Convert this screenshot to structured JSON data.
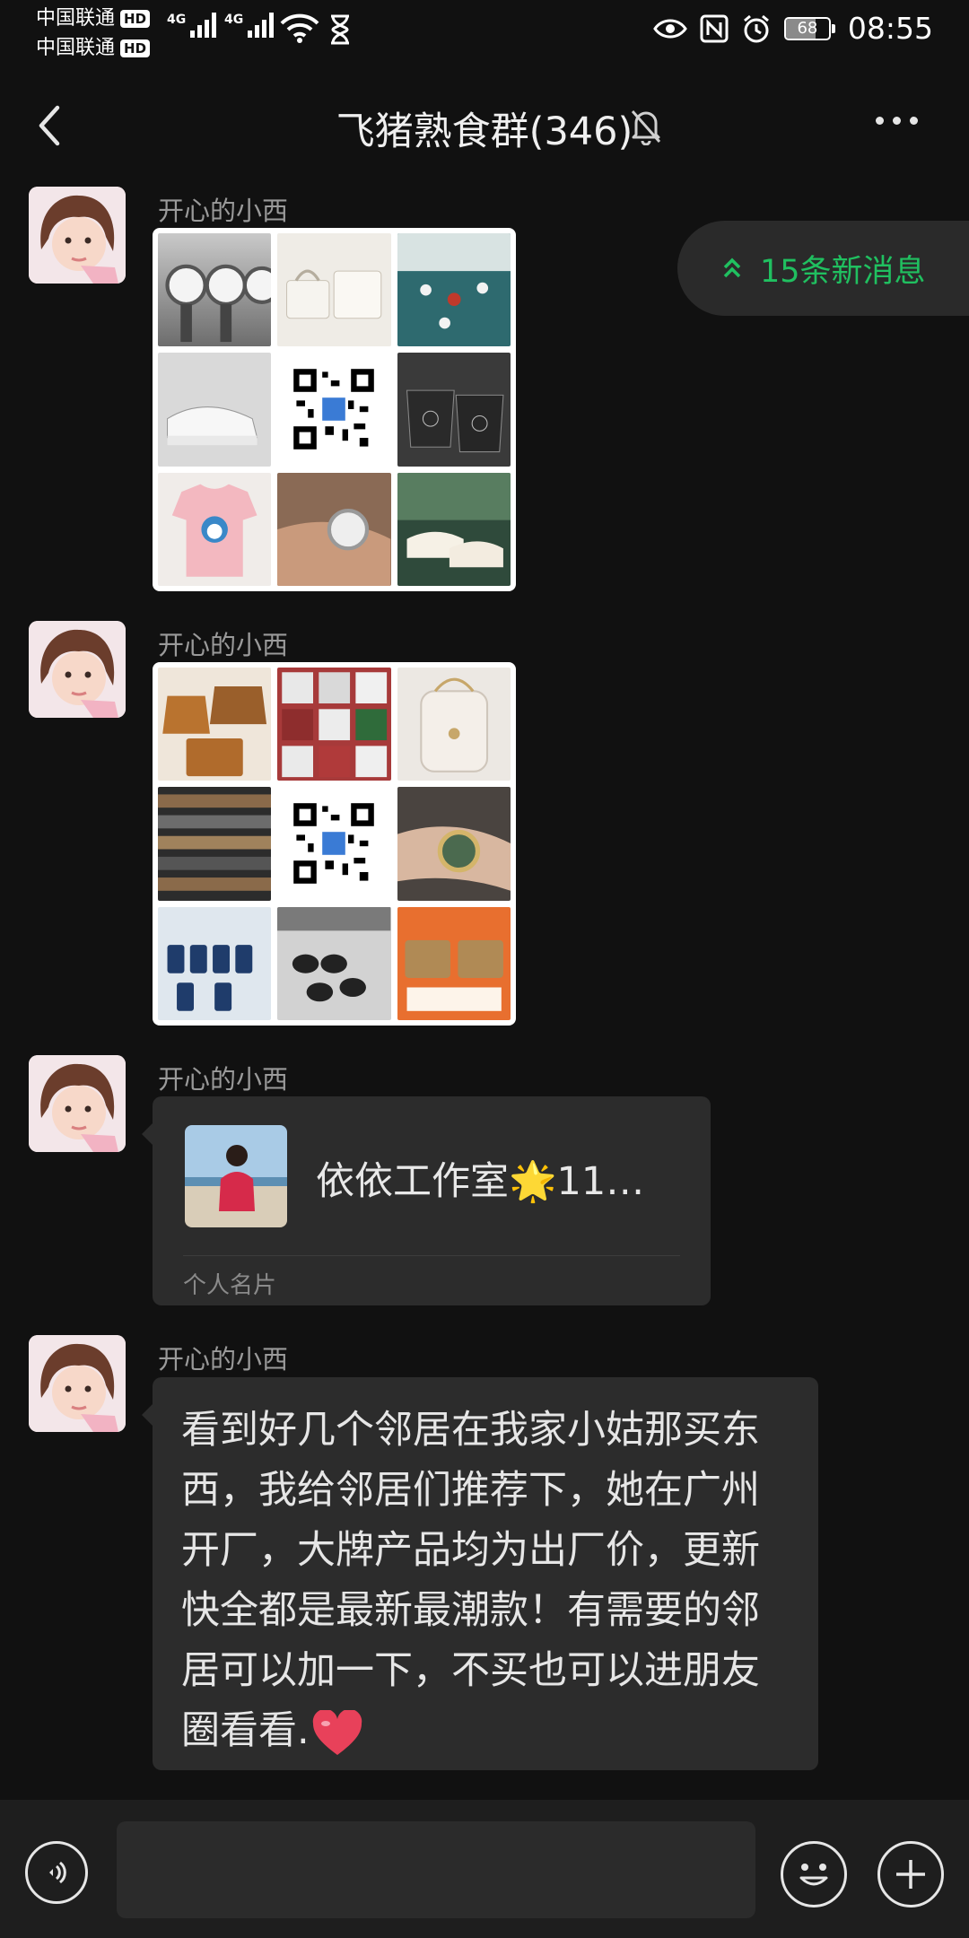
{
  "status_bar": {
    "carrier_1": "中国联通",
    "carrier_2": "中国联通",
    "hd_label": "HD",
    "network_1": "4G",
    "network_2": "4G",
    "battery_percent": "68",
    "battery_level": 0.68,
    "time": "08:55",
    "icons": [
      "wifi-icon",
      "hourglass-icon",
      "eye-icon",
      "nfc-icon",
      "alarm-icon",
      "battery-icon"
    ]
  },
  "header": {
    "title": "飞猪熟食群(346)",
    "icons": [
      "back-icon",
      "mute-bell-icon",
      "more-icon"
    ]
  },
  "new_messages": {
    "label": "15条新消息",
    "icon": "double-chevron-up-icon"
  },
  "messages": [
    {
      "sender": "开心的小西",
      "type": "image-grid"
    },
    {
      "sender": "开心的小西",
      "type": "image-grid"
    },
    {
      "sender": "开心的小西",
      "type": "contact-card",
      "card_name": "依依工作室🌟11…",
      "card_type": "个人名片"
    },
    {
      "sender": "开心的小西",
      "type": "text",
      "text": "看到好几个邻居在我家小姑那买东西，我给邻居们推荐下，她在广州开厂，大牌产品均为出厂价，更新快全都是最新最潮款！有需要的邻居可以加一下，不买也可以进朋友圈看看."
    }
  ],
  "input_bar": {
    "text_value": "",
    "icons": [
      "voice-icon",
      "emoji-icon",
      "plus-icon"
    ]
  },
  "colors": {
    "background": "#111111",
    "bubble": "#2c2c2c",
    "accent_green": "#20c060",
    "heart": "#e8415a"
  }
}
